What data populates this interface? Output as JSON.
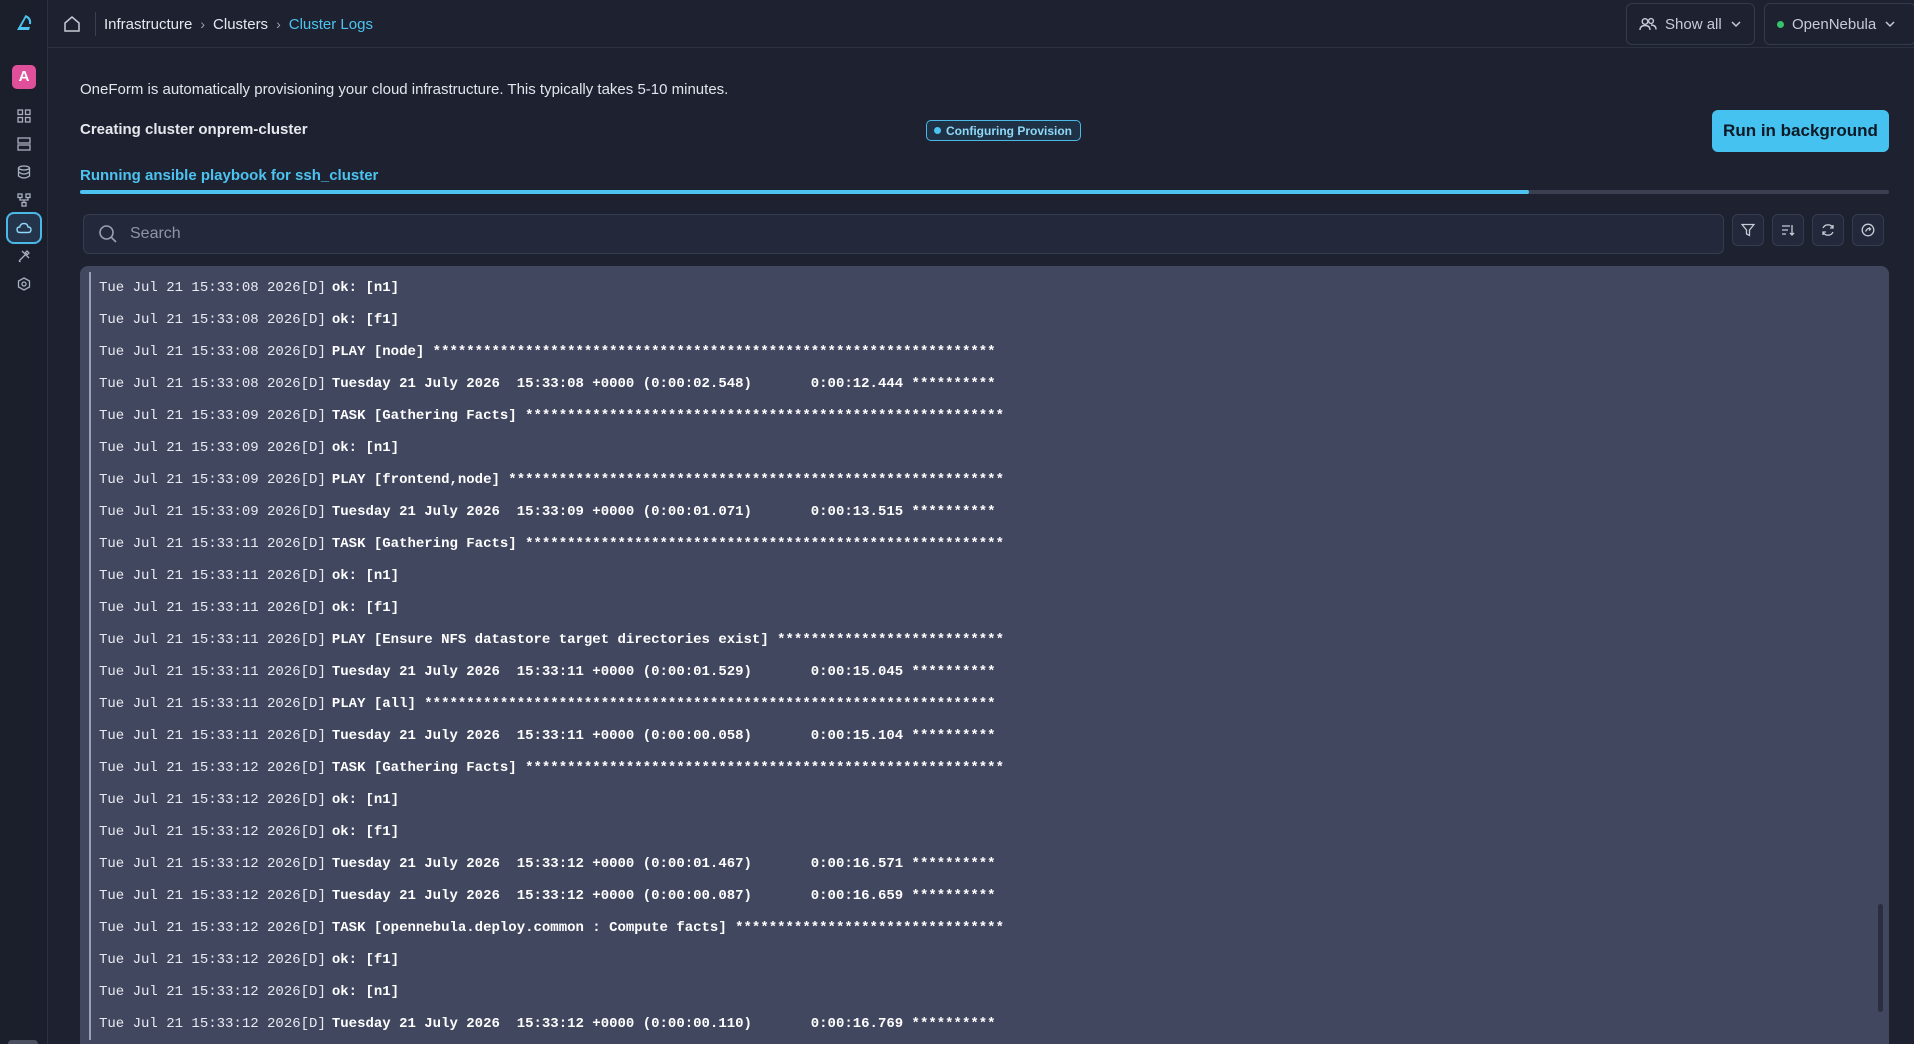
{
  "sidebar": {
    "avatar_letter": "A",
    "icons": [
      "dashboard-icon",
      "templates-icon",
      "storage-icon",
      "network-icon",
      "cloud-icon",
      "tools-icon",
      "settings-icon"
    ],
    "active_icon": "cloud-icon"
  },
  "breadcrumb": {
    "items": [
      "Infrastructure",
      "Clusters",
      "Cluster Logs"
    ]
  },
  "topbar": {
    "show_all_label": "Show all",
    "cloud_label": "OpenNebula"
  },
  "header": {
    "intro_text": "OneForm is automatically provisioning your cloud infrastructure. This typically takes 5-10 minutes.",
    "creating_text": "Creating cluster onprem-cluster",
    "status_badge": "Configuring Provision",
    "run_background_label": "Run in background"
  },
  "progress": {
    "label": "Running ansible playbook for ssh_cluster",
    "fraction": 0.801
  },
  "search": {
    "placeholder": "Search",
    "value": ""
  },
  "colors": {
    "accent": "#4cc3f0",
    "background": "#1e2230",
    "log_panel": "#424760",
    "avatar": "#e0509a",
    "status_green": "#35c46b"
  },
  "logs": [
    {
      "ts": "Tue Jul 21 15:33:08 2026",
      "lvl": "[D]",
      "msg": "ok: [n1]"
    },
    {
      "ts": "Tue Jul 21 15:33:08 2026",
      "lvl": "[D]",
      "msg": "ok: [f1]"
    },
    {
      "ts": "Tue Jul 21 15:33:08 2026",
      "lvl": "[D]",
      "msg": "PLAY [node] *******************************************************************"
    },
    {
      "ts": "Tue Jul 21 15:33:08 2026",
      "lvl": "[D]",
      "msg": "Tuesday 21 July 2026  15:33:08 +0000 (0:00:02.548)       0:00:12.444 **********"
    },
    {
      "ts": "Tue Jul 21 15:33:09 2026",
      "lvl": "[D]",
      "msg": "TASK [Gathering Facts] *********************************************************"
    },
    {
      "ts": "Tue Jul 21 15:33:09 2026",
      "lvl": "[D]",
      "msg": "ok: [n1]"
    },
    {
      "ts": "Tue Jul 21 15:33:09 2026",
      "lvl": "[D]",
      "msg": "PLAY [frontend,node] ***********************************************************"
    },
    {
      "ts": "Tue Jul 21 15:33:09 2026",
      "lvl": "[D]",
      "msg": "Tuesday 21 July 2026  15:33:09 +0000 (0:00:01.071)       0:00:13.515 **********"
    },
    {
      "ts": "Tue Jul 21 15:33:11 2026",
      "lvl": "[D]",
      "msg": "TASK [Gathering Facts] *********************************************************"
    },
    {
      "ts": "Tue Jul 21 15:33:11 2026",
      "lvl": "[D]",
      "msg": "ok: [n1]"
    },
    {
      "ts": "Tue Jul 21 15:33:11 2026",
      "lvl": "[D]",
      "msg": "ok: [f1]"
    },
    {
      "ts": "Tue Jul 21 15:33:11 2026",
      "lvl": "[D]",
      "msg": "PLAY [Ensure NFS datastore target directories exist] ***************************"
    },
    {
      "ts": "Tue Jul 21 15:33:11 2026",
      "lvl": "[D]",
      "msg": "Tuesday 21 July 2026  15:33:11 +0000 (0:00:01.529)       0:00:15.045 **********"
    },
    {
      "ts": "Tue Jul 21 15:33:11 2026",
      "lvl": "[D]",
      "msg": "PLAY [all] ********************************************************************"
    },
    {
      "ts": "Tue Jul 21 15:33:11 2026",
      "lvl": "[D]",
      "msg": "Tuesday 21 July 2026  15:33:11 +0000 (0:00:00.058)       0:00:15.104 **********"
    },
    {
      "ts": "Tue Jul 21 15:33:12 2026",
      "lvl": "[D]",
      "msg": "TASK [Gathering Facts] *********************************************************"
    },
    {
      "ts": "Tue Jul 21 15:33:12 2026",
      "lvl": "[D]",
      "msg": "ok: [n1]"
    },
    {
      "ts": "Tue Jul 21 15:33:12 2026",
      "lvl": "[D]",
      "msg": "ok: [f1]"
    },
    {
      "ts": "Tue Jul 21 15:33:12 2026",
      "lvl": "[D]",
      "msg": "Tuesday 21 July 2026  15:33:12 +0000 (0:00:01.467)       0:00:16.571 **********"
    },
    {
      "ts": "Tue Jul 21 15:33:12 2026",
      "lvl": "[D]",
      "msg": "Tuesday 21 July 2026  15:33:12 +0000 (0:00:00.087)       0:00:16.659 **********"
    },
    {
      "ts": "Tue Jul 21 15:33:12 2026",
      "lvl": "[D]",
      "msg": "TASK [opennebula.deploy.common : Compute facts] ********************************"
    },
    {
      "ts": "Tue Jul 21 15:33:12 2026",
      "lvl": "[D]",
      "msg": "ok: [f1]"
    },
    {
      "ts": "Tue Jul 21 15:33:12 2026",
      "lvl": "[D]",
      "msg": "ok: [n1]"
    },
    {
      "ts": "Tue Jul 21 15:33:12 2026",
      "lvl": "[D]",
      "msg": "Tuesday 21 July 2026  15:33:12 +0000 (0:00:00.110)       0:00:16.769 **********"
    }
  ]
}
